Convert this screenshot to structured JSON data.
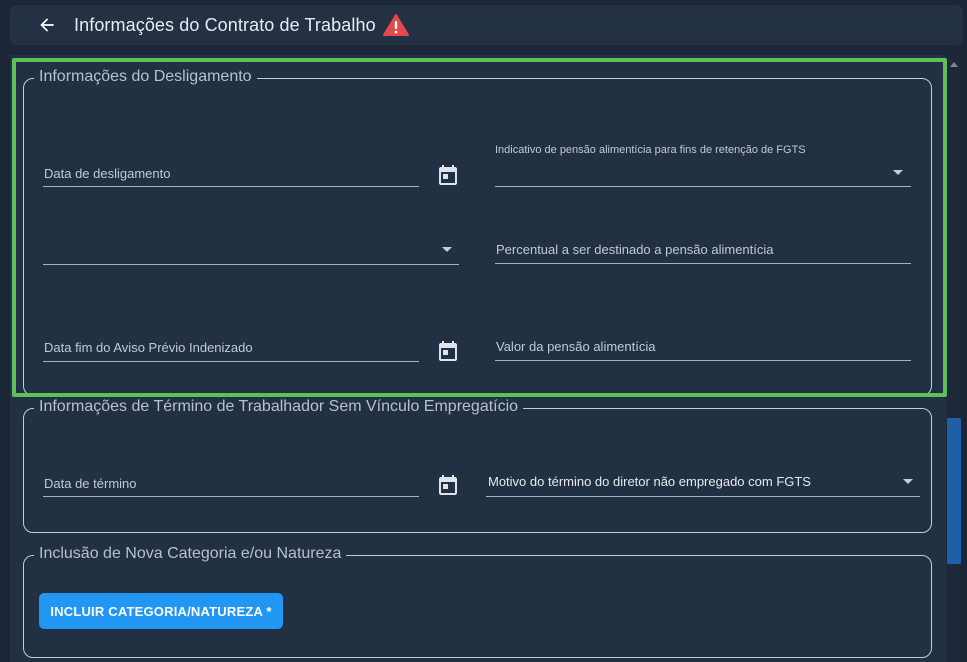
{
  "header": {
    "title": "Informações do Contrato de Trabalho",
    "back_icon": "arrow-left-icon",
    "warning_icon": "warning-triangle-icon",
    "warning_color": "#e5484d"
  },
  "sections": {
    "desligamento": {
      "legend": "Informações do Desligamento",
      "data_desligamento": {
        "label": "Data de desligamento",
        "value": ""
      },
      "indicativo_pensao": {
        "label": "Indicativo de pensão alimentícia para fins de retenção de FGTS",
        "value": ""
      },
      "unlabeled_select": {
        "value": ""
      },
      "percentual_pensao": {
        "label": "Percentual a ser destinado a pensão alimentícia",
        "value": ""
      },
      "data_fim_aviso": {
        "label": "Data fim do Aviso Prévio Indenizado",
        "value": ""
      },
      "valor_pensao": {
        "label": "Valor da pensão alimentícia",
        "value": ""
      }
    },
    "termino": {
      "legend": "Informações de Término de Trabalhador Sem Vínculo Empregatício",
      "data_termino": {
        "label": "Data de término",
        "value": ""
      },
      "motivo_termino": {
        "value": "Motivo do término do diretor não empregado com FGTS"
      }
    },
    "inclusao": {
      "legend": "Inclusão de Nova Categoria e/ou Natureza",
      "button_label": "INCLUIR CATEGORIA/NATUREZA *"
    }
  },
  "colors": {
    "background": "#1b2636",
    "panel": "#223043",
    "highlight": "#5fc05a",
    "primary": "#2196f3",
    "scroll_thumb": "#1f5fa8"
  }
}
